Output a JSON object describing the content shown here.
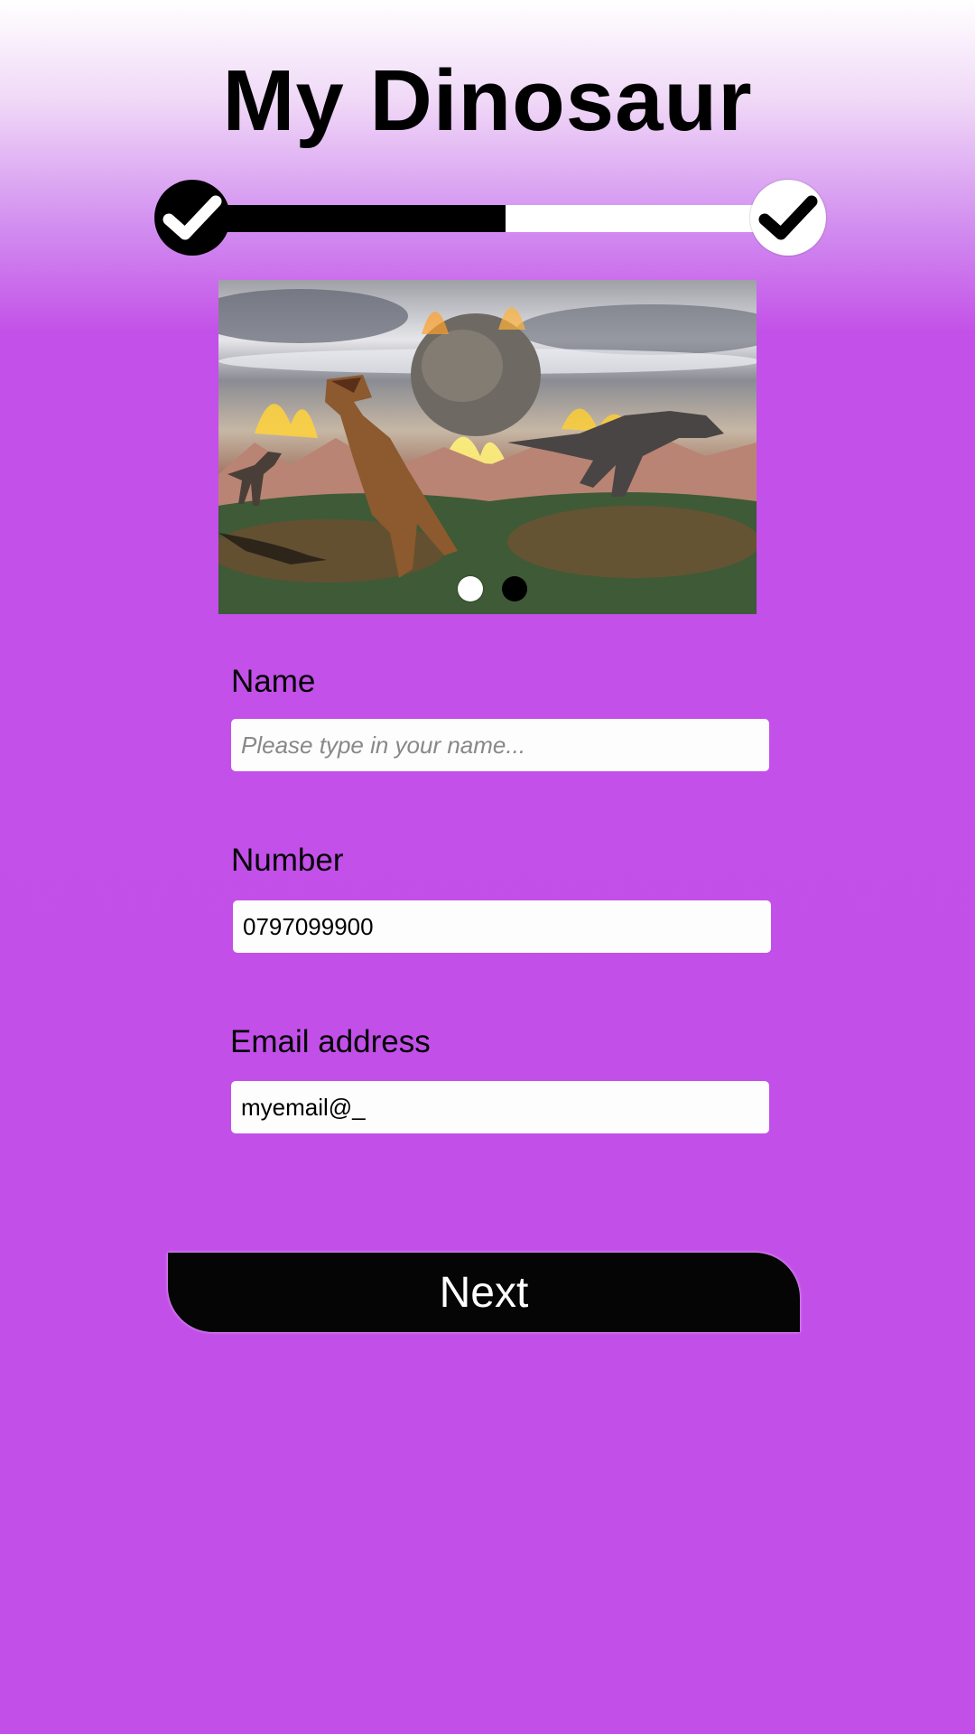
{
  "app": {
    "title": "My Dinosaur"
  },
  "progress": {
    "steps": 2,
    "completed_steps": 1,
    "fill_fraction": 0.5,
    "step_icons": [
      "check-icon",
      "check-icon"
    ]
  },
  "carousel": {
    "image": "dinosaurs-meteor-scene",
    "slides": 2,
    "active_slide": 1
  },
  "form": {
    "name": {
      "label": "Name",
      "value": "",
      "placeholder": "Please type in your name..."
    },
    "number": {
      "label": "Number",
      "value": "0797099900",
      "placeholder": ""
    },
    "email": {
      "label": "Email address",
      "value": "myemail@_",
      "placeholder": ""
    }
  },
  "actions": {
    "next_label": "Next"
  },
  "colors": {
    "background": "#c250e8",
    "accent": "#000000",
    "input_bg": "#fdfdfd"
  }
}
